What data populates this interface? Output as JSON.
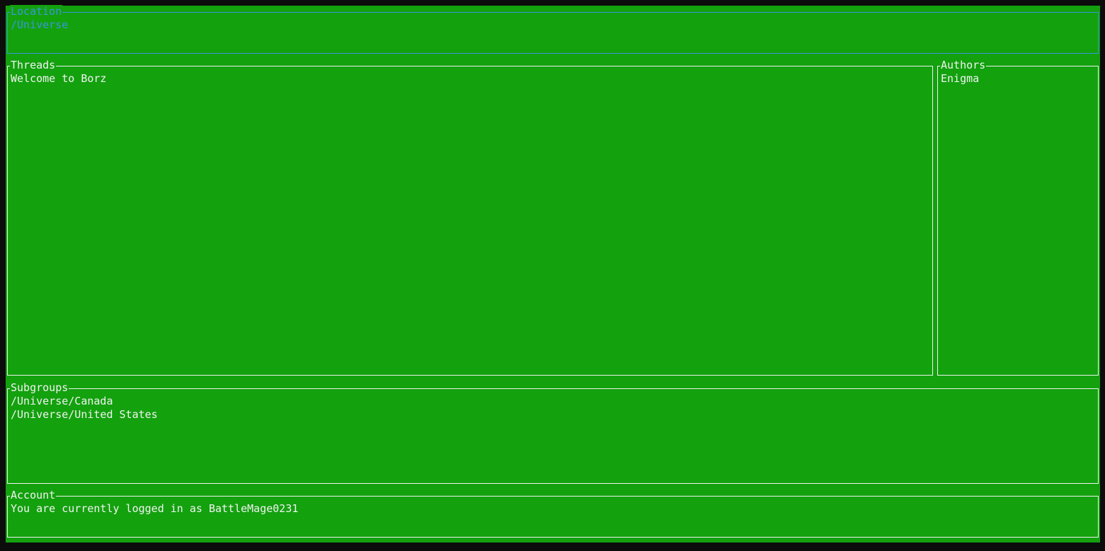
{
  "location": {
    "title": "Location",
    "path": "/Universe"
  },
  "threads": {
    "title": "Threads",
    "items": [
      "Welcome to Borz"
    ]
  },
  "authors": {
    "title": "Authors",
    "items": [
      "Enigma"
    ]
  },
  "subgroups": {
    "title": "Subgroups",
    "items": [
      "/Universe/Canada",
      "/Universe/United States"
    ]
  },
  "account": {
    "title": "Account",
    "status": "You are currently logged in as BattleMage0231"
  },
  "colors": {
    "background": "#13a10e",
    "border": "#f2f2f2",
    "text": "#f2f2f2",
    "active_accent": "#3a96dd",
    "window_frame": "#0c0c0c"
  }
}
